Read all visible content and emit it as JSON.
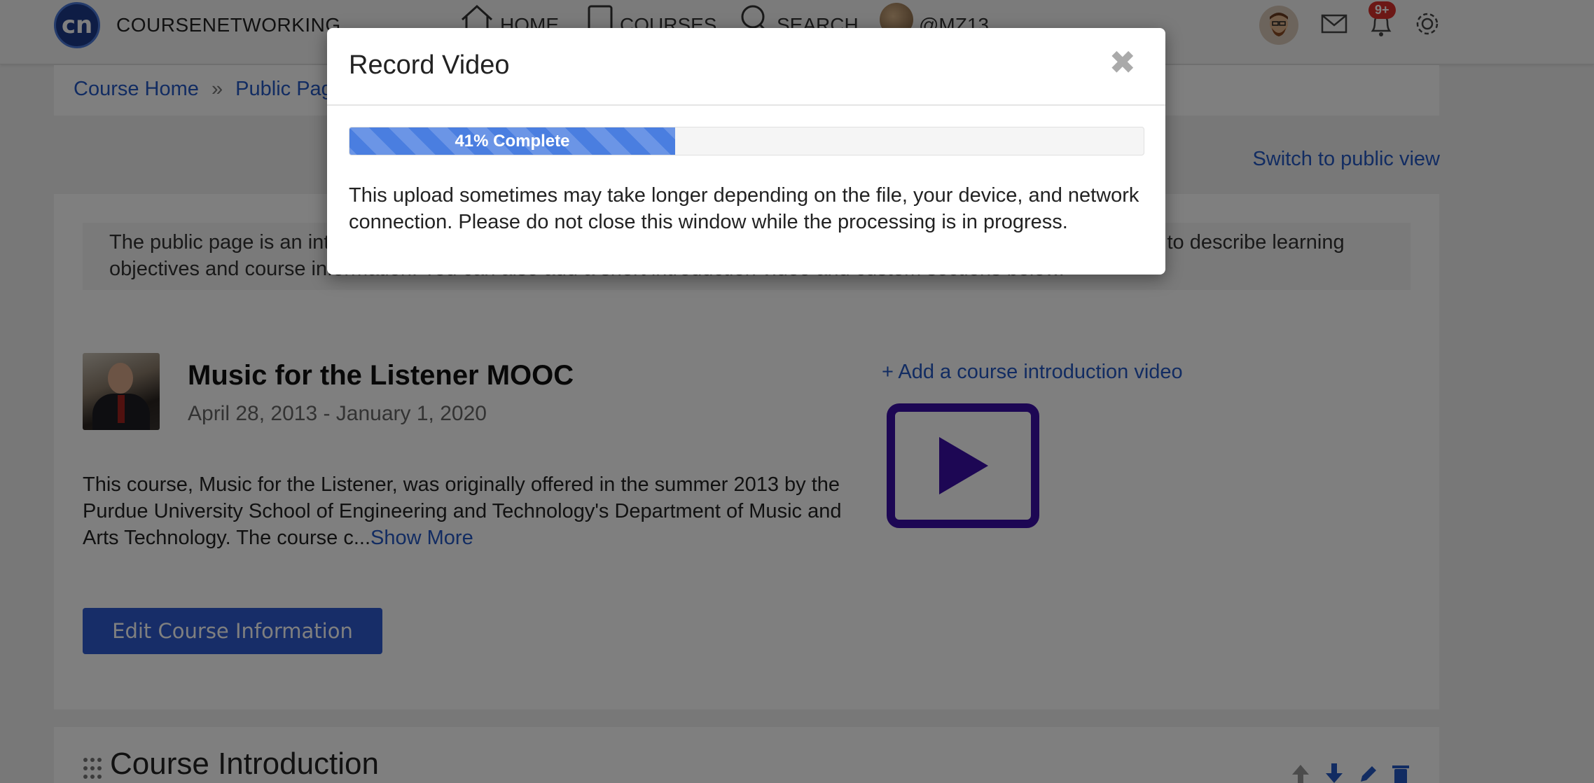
{
  "nav": {
    "brand": "COURSENETWORKING",
    "logo_text": "cn",
    "home": "HOME",
    "courses": "COURSES",
    "search": "SEARCH",
    "user": "@MZ13",
    "notification_badge": "9+"
  },
  "breadcrumb": {
    "items": [
      "Course Home",
      "Public Page"
    ]
  },
  "switch_view": "Switch to public view",
  "info": {
    "text": "The public page is an introduction to your course. It is shown to people who are not yet a member of it. You can use it to describe learning objectives and course information. You can also add a short introduction video and custom sections below."
  },
  "course": {
    "title": "Music for the Listener MOOC",
    "dates": "April 28, 2013 - January 1, 2020",
    "description": "This course, Music for the Listener, was originally offered in the summer 2013 by the Purdue University School of Engineering and Technology's Department of Music and Arts Technology. The course c...",
    "show_more": "Show More",
    "edit_button": "Edit Course Information",
    "add_video": "+ Add a course introduction video"
  },
  "section": {
    "title": "Course Introduction"
  },
  "modal": {
    "title": "Record Video",
    "close": "✖",
    "progress_label": "41% Complete",
    "progress_value": 0.41,
    "message": "This upload sometimes may take longer depending on the file, your device, and network connection. Please do not close this window while the processing is in progress."
  },
  "colors": {
    "link": "#2458c4",
    "primary_button": "#2f5bd0",
    "progress": "#4a7ee0",
    "video_icon": "#3b0fa8",
    "badge": "#d9302c"
  }
}
